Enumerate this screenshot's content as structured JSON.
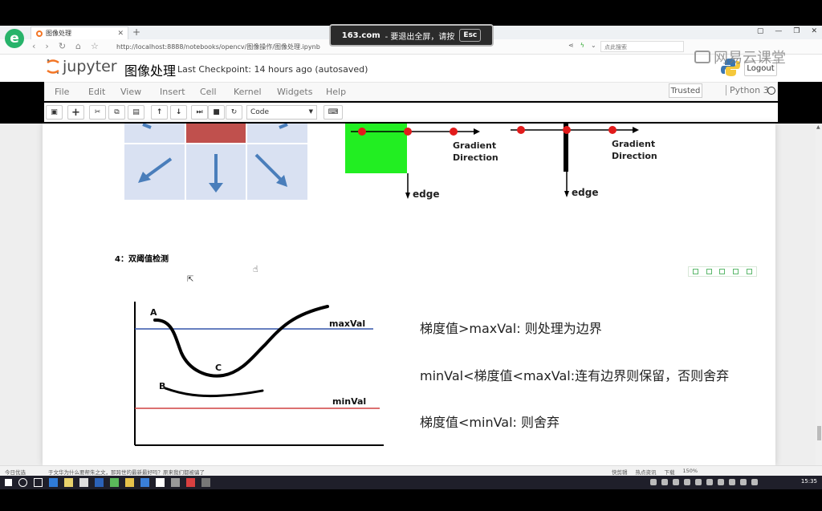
{
  "fullscreen_banner": {
    "site": "163.com",
    "text": "- 要退出全屏，请按",
    "key": "Esc"
  },
  "browser": {
    "tab_title": "图像处理",
    "new_tab": "+",
    "url": "http://localhost:8888/notebooks/opencv/图像操作/图像处理.ipynb",
    "search_placeholder": "点此搜索",
    "window_controls": [
      "▢",
      "—",
      "❐",
      "✕"
    ]
  },
  "watermark": "网易云课堂",
  "jupyter": {
    "logo_text": "jupyter",
    "notebook_title": "图像处理",
    "checkpoint": "Last Checkpoint: 14 hours ago (autosaved)",
    "logout": "Logout",
    "menu": [
      "File",
      "Edit",
      "View",
      "Insert",
      "Cell",
      "Kernel",
      "Widgets",
      "Help"
    ],
    "trusted": "Trusted",
    "kernel_name": "Python 3",
    "cell_type": "Code",
    "toolbar_icons": [
      "save-icon",
      "add-cell-icon",
      "cut-icon",
      "copy-icon",
      "paste-icon",
      "move-up-icon",
      "move-down-icon",
      "run-icon",
      "stop-icon",
      "restart-icon",
      "keyboard-icon"
    ]
  },
  "figure_top": {
    "gradient_label_1": "Gradient\nDirection",
    "edge_label_1": "edge",
    "gradient_label_2": "Gradient\nDirection",
    "edge_label_2": "edge"
  },
  "section": {
    "heading": "4：双阈值检测",
    "graph_labels": {
      "A": "A",
      "B": "B",
      "C": "C",
      "max": "maxVal",
      "min": "minVal"
    },
    "rules": [
      "梯度值>maxVal: 则处理为边界",
      "minVal<梯度值<maxVal:连有边界则保留，否则舍弃",
      "梯度值<minVal: 则舍弃"
    ]
  },
  "statusbar": {
    "left": "今日优选",
    "news": "于文华为什么要帮朱之文，那跨世的最新最好吗？原来我们都被骗了",
    "right": [
      "快剪辑",
      "热点资讯",
      "下载",
      "150%"
    ]
  },
  "taskbar": {
    "clock": "15:35"
  },
  "colors": {
    "accent_orange": "#f37626",
    "max_line": "#3355aa",
    "min_line": "#d04040",
    "edge_green": "#22ee22"
  }
}
